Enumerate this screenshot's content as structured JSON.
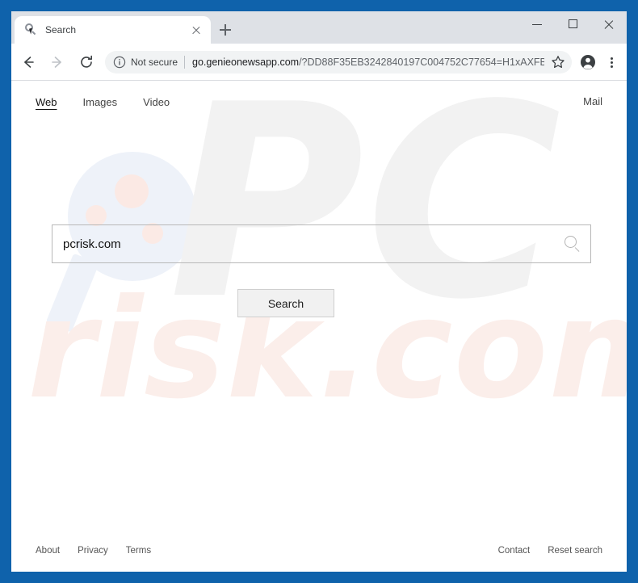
{
  "window": {
    "frame_color": "#0f62ab",
    "controls": {
      "minimize": "minimize",
      "maximize": "maximize",
      "close": "close"
    }
  },
  "browser": {
    "tab": {
      "title": "Search",
      "favicon": "magnifier-cursor-icon",
      "close_label": "Close tab"
    },
    "new_tab_label": "New tab",
    "nav": {
      "back": "Back",
      "forward": "Forward",
      "reload": "Reload"
    },
    "omnibox": {
      "security_icon": "info-circle-icon",
      "security_label": "Not secure",
      "url_host": "go.genieonewsapp.com",
      "url_path": "/?DD88F35EB3242840197C004752C77654=H1xAXFB...",
      "url_full": "go.genieonewsapp.com/?DD88F35EB3242840197C004752C77654=H1xAXFB..."
    },
    "actions": {
      "bookmark": "star-icon",
      "profile": "account-avatar-icon",
      "menu": "three-dot-menu-icon"
    }
  },
  "page": {
    "nav": {
      "left_items": [
        {
          "label": "Web",
          "active": true
        },
        {
          "label": "Images",
          "active": false
        },
        {
          "label": "Video",
          "active": false
        }
      ],
      "right_items": [
        {
          "label": "Mail"
        }
      ]
    },
    "search": {
      "value": "pcrisk.com",
      "placeholder": "",
      "icon": "magnifier-icon",
      "button_label": "Search"
    },
    "watermark": {
      "logo": "pcrisk-magnifier-logo",
      "primary_text": "PC",
      "primary_color": "#f2f2f2",
      "secondary_text": "risk.com",
      "secondary_color": "#fbeeea"
    },
    "footer": {
      "left_links": [
        "About",
        "Privacy",
        "Terms"
      ],
      "right_links": [
        "Contact",
        "Reset search"
      ]
    }
  }
}
